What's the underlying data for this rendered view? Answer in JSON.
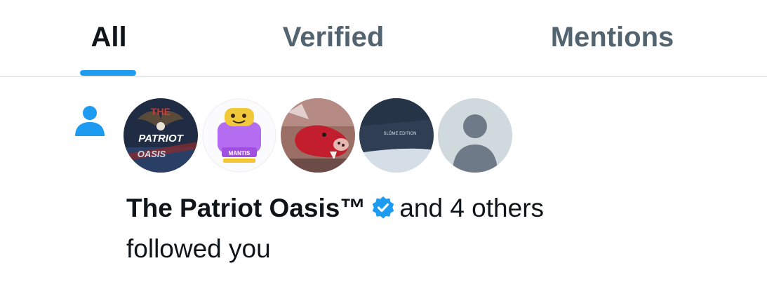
{
  "tabs": [
    {
      "label": "All",
      "active": true
    },
    {
      "label": "Verified",
      "active": false
    },
    {
      "label": "Mentions",
      "active": false
    }
  ],
  "notification": {
    "icon": "person-icon",
    "actor_name": "The Patriot Oasis™",
    "actor_verified": true,
    "others_text": "and 4 others",
    "action_text": "followed you",
    "avatars": [
      {
        "name": "patriot-oasis-avatar",
        "text_top": "THE",
        "text_mid": "PATRIOT",
        "text_bottom": "OASIS"
      },
      {
        "name": "mantis-avatar",
        "text": "MANTIS"
      },
      {
        "name": "boar-avatar"
      },
      {
        "name": "dark-cap-avatar",
        "text": "SLŌME EDITION"
      },
      {
        "name": "default-avatar"
      }
    ]
  },
  "colors": {
    "accent": "#1d9bf0",
    "text_primary": "#0f1419",
    "text_secondary": "#536471",
    "divider": "#e6e9ec"
  }
}
